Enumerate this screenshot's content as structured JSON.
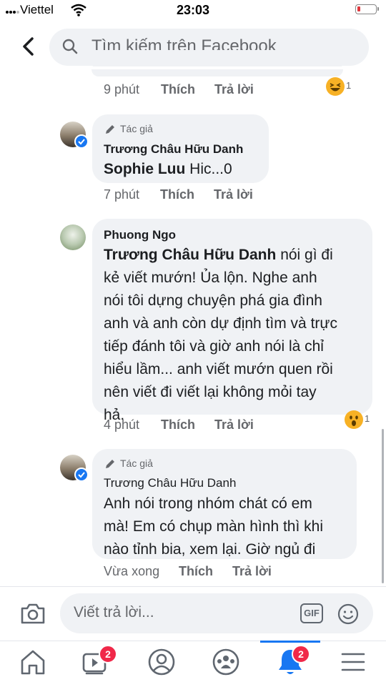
{
  "status_bar": {
    "carrier": "Viettel",
    "time": "23:03"
  },
  "search": {
    "placeholder": "Tìm kiếm trên Facebook"
  },
  "colors": {
    "accent": "#1877f2",
    "badge": "#f02849",
    "bubble": "#f0f2f5",
    "meta": "#65676b"
  },
  "top_actions": {
    "time": "9 phút",
    "like": "Thích",
    "reply": "Trả lời",
    "reaction_count": "1",
    "reaction_icon": "laughing-emoji-icon"
  },
  "comments": [
    {
      "author_tag": "Tác giả",
      "name": "Trương Châu Hữu Danh",
      "mention": "Sophie Luu",
      "text": "Hic...0",
      "time": "7 phút",
      "like": "Thích",
      "reply": "Trả lời"
    },
    {
      "name": "Phuong Ngo",
      "mention": "Trương Châu Hữu Danh",
      "line1": "nói gì đi",
      "line2": "kẻ viết mướn! Ủa lộn. Nghe anh",
      "line3": "nói tôi dựng chuyện phá gia đình",
      "line4": "anh và anh còn dự định tìm và trực",
      "line5": "tiếp đánh tôi và giờ anh nói là chỉ",
      "line6": "hiểu lầm... anh viết mướn quen rồi",
      "line7": "nên viết đi viết lại không mỏi tay",
      "line8": "hả.",
      "time": "4 phút",
      "like": "Thích",
      "reply": "Trả lời",
      "reaction_count": "1",
      "reaction_icon": "wow-emoji-icon"
    },
    {
      "author_tag": "Tác giả",
      "name": "Trương Châu Hữu Danh",
      "line1": "Anh nói trong nhóm chát có em",
      "line2": "mà! Em có chụp màn hình thì khi",
      "line3": "nào tỉnh bia, xem lại. Giờ ngủ đi",
      "time": "Vừa xong",
      "like": "Thích",
      "reply": "Trả lời"
    }
  ],
  "composer": {
    "placeholder": "Viết trả lời...",
    "gif_label": "GIF"
  },
  "bottom_nav": {
    "video_badge": "2",
    "notifications_badge": "2"
  }
}
